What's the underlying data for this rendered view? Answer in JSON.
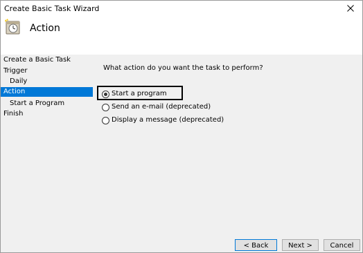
{
  "window": {
    "title": "Create Basic Task Wizard",
    "close_glyph": "close-icon"
  },
  "header": {
    "title": "Action",
    "icon": "task-scheduler-icon"
  },
  "steps": [
    {
      "label": "Create a Basic Task",
      "indent": false,
      "selected": false
    },
    {
      "label": "Trigger",
      "indent": false,
      "selected": false
    },
    {
      "label": "Daily",
      "indent": true,
      "selected": false
    },
    {
      "label": "Action",
      "indent": false,
      "selected": true
    },
    {
      "label": "Start a Program",
      "indent": true,
      "selected": false
    },
    {
      "label": "Finish",
      "indent": false,
      "selected": false
    }
  ],
  "main": {
    "prompt": "What action do you want the task to perform?",
    "options": [
      {
        "label": "Start a program",
        "checked": true
      },
      {
        "label": "Send an e-mail (deprecated)",
        "checked": false
      },
      {
        "label": "Display a message (deprecated)",
        "checked": false
      }
    ]
  },
  "buttons": {
    "back": "< Back",
    "next": "Next >",
    "cancel": "Cancel"
  },
  "colors": {
    "selected_step_bg": "#0078d7",
    "body_bg": "#f0f0f0",
    "highlight_border": "#000000"
  }
}
